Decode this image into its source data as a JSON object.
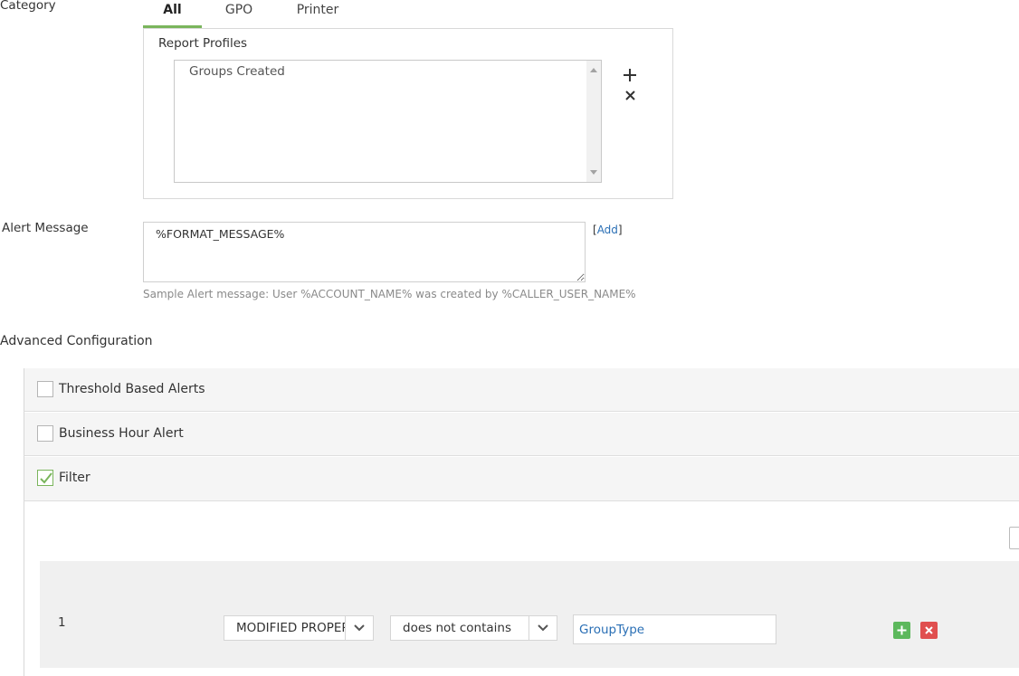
{
  "category": {
    "label": "Category",
    "tabs": [
      {
        "label": "All",
        "active": true
      },
      {
        "label": "GPO",
        "active": false
      },
      {
        "label": "Printer",
        "active": false
      }
    ]
  },
  "report_profiles": {
    "title": "Report Profiles",
    "items": [
      "Groups Created"
    ],
    "add_icon": "plus-icon",
    "remove_icon": "close-icon"
  },
  "alert_message": {
    "label": "Alert Message",
    "value": "%FORMAT_MESSAGE%",
    "add_link": "Add",
    "hint": "Sample Alert message: User %ACCOUNT_NAME% was created by %CALLER_USER_NAME%"
  },
  "advanced": {
    "label": "Advanced Configuration",
    "options": [
      {
        "label": "Threshold Based Alerts",
        "checked": false
      },
      {
        "label": "Business Hour Alert",
        "checked": false
      },
      {
        "label": "Filter",
        "checked": true
      }
    ]
  },
  "filter": {
    "rows": [
      {
        "index": "1",
        "field": "MODIFIED PROPERTIES",
        "operator": "does not contains",
        "value": "GroupType"
      }
    ]
  },
  "colors": {
    "accent_green": "#7ab55c",
    "link_blue": "#2a6fb5",
    "add_green": "#5cb85c",
    "delete_red": "#e04f4f"
  }
}
